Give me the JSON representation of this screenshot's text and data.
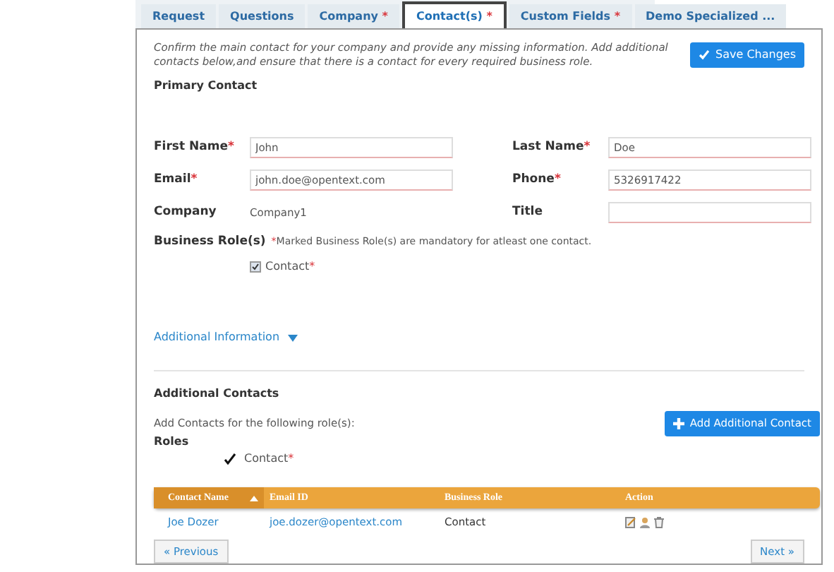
{
  "required_marker": "*",
  "tabs": [
    {
      "label": "Request",
      "required": false,
      "selected": false
    },
    {
      "label": "Questions",
      "required": false,
      "selected": false
    },
    {
      "label": "Company",
      "required": true,
      "selected": false
    },
    {
      "label": "Contact(s)",
      "required": true,
      "selected": true
    },
    {
      "label": "Custom Fields",
      "required": true,
      "selected": false
    },
    {
      "label": "Demo Specialized ...",
      "required": false,
      "selected": false
    }
  ],
  "intro": "Confirm the main contact for your company and provide any missing information. Add additional contacts below,and ensure that there is a contact for every required business role.",
  "save_button": "Save Changes",
  "primary_contact": {
    "heading": "Primary Contact",
    "fields": [
      {
        "label": "First Name",
        "required": true,
        "kind": "input",
        "value": "John"
      },
      {
        "label": "Last Name",
        "required": true,
        "kind": "input",
        "value": "Doe"
      },
      {
        "label": "Email",
        "required": true,
        "kind": "input",
        "value": "john.doe@opentext.com"
      },
      {
        "label": "Phone",
        "required": true,
        "kind": "input",
        "value": "5326917422"
      },
      {
        "label": "Company",
        "required": false,
        "kind": "text",
        "value": "Company1"
      },
      {
        "label": "Title",
        "required": false,
        "kind": "input"
      }
    ],
    "business_roles": {
      "label": "Business Role(s)",
      "note": "Marked Business Role(s) are mandatory for atleast one contact.",
      "roles": [
        {
          "label": "Contact",
          "required": true,
          "checked": true
        }
      ]
    }
  },
  "additional_information": {
    "label": "Additional Information",
    "expanded": false
  },
  "additional_contacts": {
    "heading": "Additional Contacts",
    "hint": "Add Contacts for the following role(s):",
    "add_button": "Add Additional Contact",
    "roles_label": "Roles",
    "roles": [
      {
        "label": "Contact",
        "required": true,
        "checked": true
      }
    ],
    "table": {
      "columns": [
        {
          "label": "Contact Name",
          "sorted": true
        },
        {
          "label": "Email ID",
          "sorted": false
        },
        {
          "label": "Business Role",
          "sorted": false
        },
        {
          "label": "Action",
          "sorted": false
        }
      ],
      "rows": [
        {
          "name": "Joe Dozer",
          "email": "joe.dozer@opentext.com",
          "role": "Contact"
        }
      ]
    }
  },
  "previous_button": "« Previous",
  "next_button": "Next »"
}
